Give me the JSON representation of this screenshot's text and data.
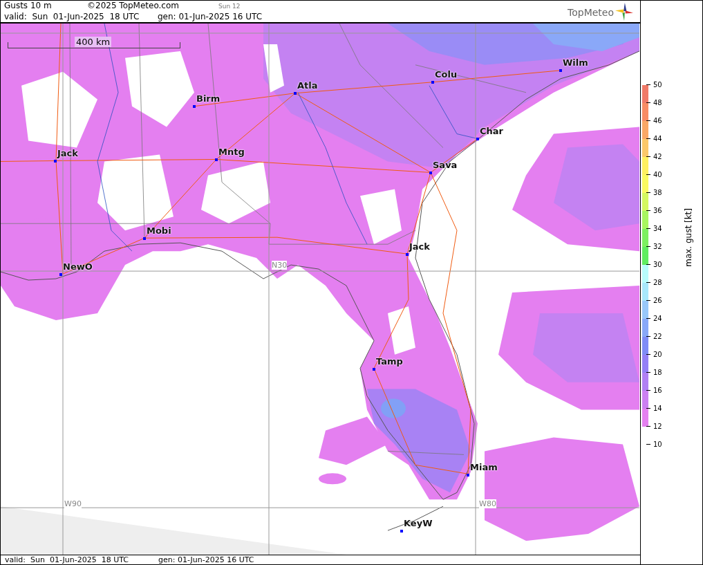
{
  "header": {
    "title": "Gusts 10 m",
    "copyright": "©2025 TopMeteo.com",
    "run": "Sun 12",
    "valid": "valid:  Sun  01-Jun-2025  18 UTC",
    "generated": "gen: 01-Jun-2025 16 UTC",
    "logo": "TopMeteo"
  },
  "map": {
    "scale": "400 km",
    "grid_labels": [
      "N30",
      "W90",
      "W80"
    ],
    "cities": [
      {
        "name": "Wilm"
      },
      {
        "name": "Colu"
      },
      {
        "name": "Atla"
      },
      {
        "name": "Birm"
      },
      {
        "name": "Char"
      },
      {
        "name": "Jack"
      },
      {
        "name": "Mntg"
      },
      {
        "name": "Sava"
      },
      {
        "name": "Mobi"
      },
      {
        "name": "Jack"
      },
      {
        "name": "NewO"
      },
      {
        "name": "Tamp"
      },
      {
        "name": "Miam"
      },
      {
        "name": "KeyW"
      }
    ]
  },
  "legend": {
    "title": "max. gust [kt]",
    "bins": [
      {
        "color": "#f07a68"
      },
      {
        "color": "#f88c64"
      },
      {
        "color": "#faa866"
      },
      {
        "color": "#fcc86a"
      },
      {
        "color": "#fff060"
      },
      {
        "color": "#fafa60"
      },
      {
        "color": "#d4f860"
      },
      {
        "color": "#a8f660"
      },
      {
        "color": "#7cf060"
      },
      {
        "color": "#60ec60"
      },
      {
        "color": "#b8fcfc"
      },
      {
        "color": "#a8e8fc"
      },
      {
        "color": "#98c8fa"
      },
      {
        "color": "#88a8f8"
      },
      {
        "color": "#7f8cf6"
      },
      {
        "color": "#9480f6"
      },
      {
        "color": "#b080f4"
      },
      {
        "color": "#cc80f2"
      },
      {
        "color": "#e480f0"
      }
    ],
    "ticks": [
      "50",
      "48",
      "46",
      "44",
      "42",
      "40",
      "38",
      "36",
      "34",
      "32",
      "30",
      "28",
      "26",
      "24",
      "22",
      "20",
      "18",
      "16",
      "14",
      "12",
      "10"
    ]
  },
  "footer": {
    "valid": "valid:  Sun  01-Jun-2025  18 UTC",
    "generated": "gen: 01-Jun-2025 16 UTC"
  }
}
